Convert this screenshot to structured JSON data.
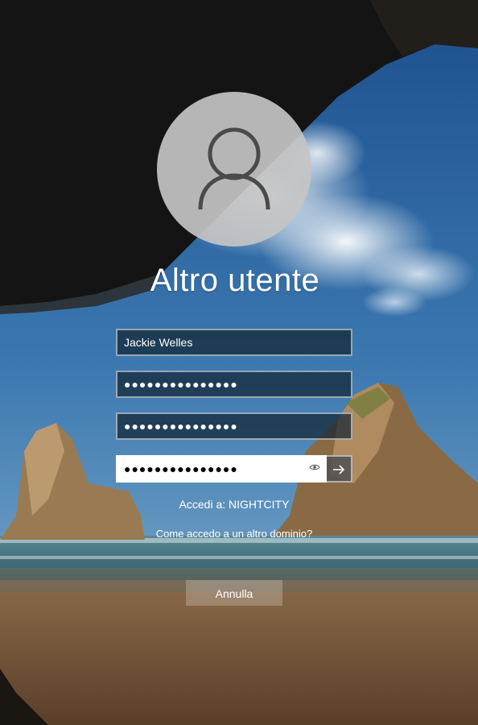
{
  "user": {
    "display_name": "Altro utente"
  },
  "fields": {
    "username": {
      "value": "Jackie Welles"
    },
    "password1": {
      "value": "●●●●●●●●●●●●●●●"
    },
    "password2": {
      "value": "●●●●●●●●●●●●●●●"
    },
    "password3": {
      "value": "●●●●●●●●●●●●●●●"
    }
  },
  "signin": {
    "domain_label": "Accedi a: NIGHTCITY"
  },
  "links": {
    "other_domain": "Come accedo a un altro dominio?"
  },
  "buttons": {
    "cancel": "Annulla"
  },
  "icons": {
    "avatar": "user-avatar-icon",
    "reveal": "eye-icon",
    "submit": "arrow-right-icon"
  },
  "colors": {
    "sky": "#3a6fa3",
    "field_bg": "#14262f",
    "submit_bg": "#505050"
  }
}
